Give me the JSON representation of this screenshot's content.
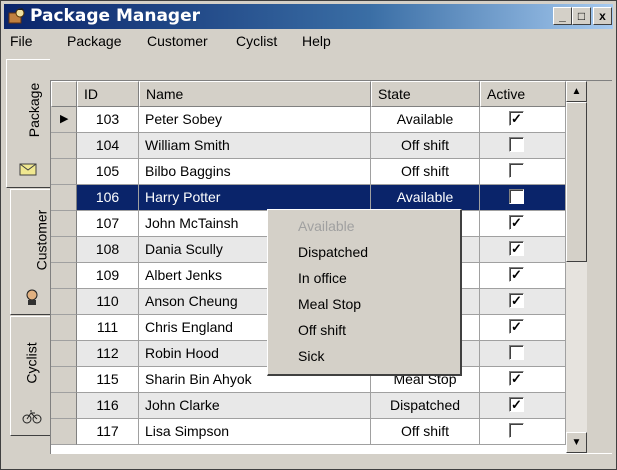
{
  "window": {
    "title": "Package Manager",
    "controls": [
      "_",
      "□",
      "x"
    ]
  },
  "menu": [
    "File",
    "Package",
    "Customer",
    "Cyclist",
    "Help"
  ],
  "side_tabs": [
    {
      "label": "Package",
      "icon": "envelope-icon"
    },
    {
      "label": "Customer",
      "icon": "person-icon"
    },
    {
      "label": "Cyclist",
      "icon": "bicycle-icon"
    }
  ],
  "table": {
    "columns": [
      "ID",
      "Name",
      "State",
      "Active"
    ],
    "rows": [
      {
        "id": "103",
        "name": "Peter Sobey",
        "state": "Available",
        "active": true,
        "current": true
      },
      {
        "id": "104",
        "name": "William Smith",
        "state": "Off shift",
        "active": false
      },
      {
        "id": "105",
        "name": "Bilbo Baggins",
        "state": "Off shift",
        "active": false
      },
      {
        "id": "106",
        "name": "Harry Potter",
        "state": "Available",
        "active": false,
        "selected": true
      },
      {
        "id": "107",
        "name": "John McTainsh",
        "state": "d",
        "active": true
      },
      {
        "id": "108",
        "name": "Dania Scully",
        "state": "",
        "active": true
      },
      {
        "id": "109",
        "name": "Albert Jenks",
        "state": "",
        "active": true
      },
      {
        "id": "110",
        "name": "Anson Cheung",
        "state": "d",
        "active": true
      },
      {
        "id": "111",
        "name": "Chris England",
        "state": "",
        "active": true
      },
      {
        "id": "112",
        "name": "Robin Hood",
        "state": "",
        "active": false
      },
      {
        "id": "115",
        "name": "Sharin Bin Ahyok",
        "state": "Meal Stop",
        "active": true
      },
      {
        "id": "116",
        "name": "John Clarke",
        "state": "Dispatched",
        "active": true
      },
      {
        "id": "117",
        "name": "Lisa Simpson",
        "state": "Off shift",
        "active": false
      }
    ]
  },
  "context_menu": [
    {
      "label": "Available",
      "disabled": true
    },
    {
      "label": "Dispatched"
    },
    {
      "label": "In office"
    },
    {
      "label": "Meal Stop"
    },
    {
      "label": "Off shift"
    },
    {
      "label": "Sick"
    }
  ],
  "colors": {
    "selection": "#0a246a",
    "face": "#d4d0c8",
    "alt_row": "#e8e8e8"
  }
}
